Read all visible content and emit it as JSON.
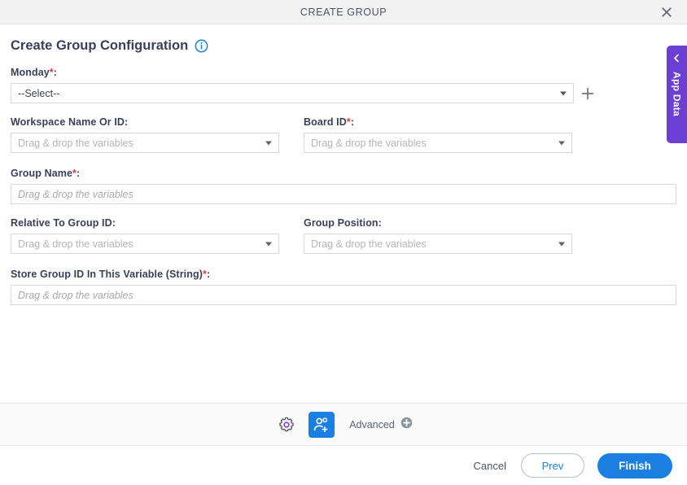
{
  "window": {
    "title": "CREATE GROUP",
    "close_icon": "close-icon"
  },
  "page": {
    "heading": "Create Group Configuration",
    "info_icon": "info-icon"
  },
  "side_tab": {
    "label": "App Data",
    "chevron_icon": "chevron-left-icon"
  },
  "form": {
    "monday": {
      "label": "Monday",
      "required": "*",
      "colon": ":",
      "value": "--Select--",
      "add_icon": "plus-icon"
    },
    "workspace": {
      "label": "Workspace Name Or ID",
      "required": "",
      "colon": ":",
      "placeholder": "Drag & drop the variables"
    },
    "board_id": {
      "label": "Board ID",
      "required": "*",
      "colon": ":",
      "placeholder": "Drag & drop the variables"
    },
    "group_name": {
      "label": "Group Name",
      "required": "*",
      "colon": ":",
      "placeholder": "Drag & drop the variables"
    },
    "relative_to_group_id": {
      "label": "Relative To Group ID",
      "required": "",
      "colon": ":",
      "placeholder": "Drag & drop the variables"
    },
    "group_position": {
      "label": "Group Position",
      "required": "",
      "colon": ":",
      "placeholder": "Drag & drop the variables"
    },
    "store_group_id": {
      "label": "Store Group ID In This Variable (String)",
      "required": "*",
      "colon": ":",
      "placeholder": "Drag & drop the variables"
    }
  },
  "toolbar": {
    "settings_icon": "gear-icon",
    "people_icon": "add-people-icon",
    "advanced_label": "Advanced",
    "advanced_add_icon": "circle-plus-icon"
  },
  "footer": {
    "cancel_label": "Cancel",
    "prev_label": "Prev",
    "finish_label": "Finish"
  },
  "colors": {
    "accent_blue": "#1a7fe0",
    "purple": "#6b3fd4",
    "required_red": "#e03a3a",
    "text_dark": "#39415a"
  }
}
